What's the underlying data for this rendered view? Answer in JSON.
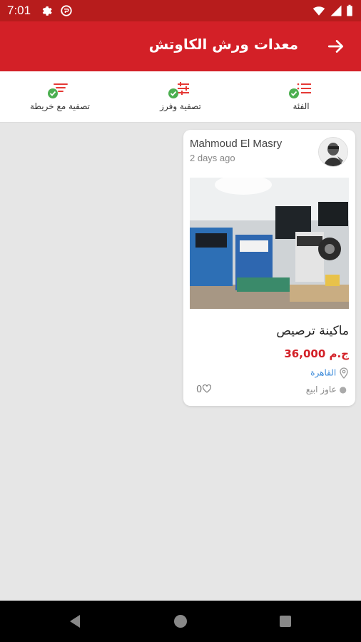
{
  "status_bar": {
    "time": "7:01"
  },
  "app_bar": {
    "title": "معدات ورش الكاوتش"
  },
  "filters": [
    {
      "label": "تصفية مع خريطة",
      "icon": "sort-filter-icon",
      "active": true
    },
    {
      "label": "تصفية وفرز",
      "icon": "sliders-icon",
      "active": true
    },
    {
      "label": "الفئة",
      "icon": "category-list-icon",
      "active": true
    }
  ],
  "listing": {
    "seller_name": "Mahmoud El Masry",
    "posted": "2 days ago",
    "title": "ماكينة ترصيص",
    "price": "ج.م 36,000",
    "location": "القاهرة",
    "condition": "عاوز ابيع",
    "likes": "0"
  },
  "colors": {
    "primary": "#d32027",
    "status_bar": "#b71c1c",
    "check": "#4caf50",
    "link": "#3b8ad9"
  }
}
